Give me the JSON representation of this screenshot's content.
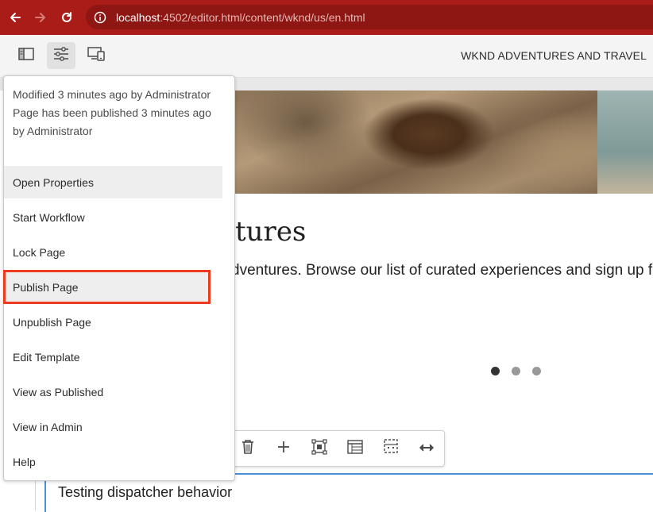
{
  "browser": {
    "url_host": "localhost",
    "url_rest": ":4502/editor.html/content/wknd/us/en.html",
    "icons": [
      "back-arrow-icon",
      "forward-arrow-icon",
      "reload-icon",
      "site-info-icon"
    ]
  },
  "toolbar": {
    "page_name": "WKND ADVENTURES AND TRAVEL",
    "buttons": [
      "side-panel-toggle",
      "page-information",
      "emulator"
    ]
  },
  "page": {
    "hero_title": "tures",
    "hero_text": "dventures. Browse our list of curated experiences and sign up fo",
    "carousel_dots": 3,
    "carousel_active_index": 0,
    "selected_component_text": "Testing dispatcher behavior"
  },
  "popover": {
    "info_line1": "Modified 3 minutes ago by Administrator",
    "info_line2": "Page has been published 3 minutes ago by Administrator",
    "items": [
      {
        "label": "Open Properties"
      },
      {
        "label": "Start Workflow"
      },
      {
        "label": "Lock Page"
      },
      {
        "label": "Publish Page"
      },
      {
        "label": "Unpublish Page"
      },
      {
        "label": "Edit Template"
      },
      {
        "label": "View as Published"
      },
      {
        "label": "View in Admin"
      },
      {
        "label": "Help"
      }
    ],
    "highlighted_item": "Publish Page"
  },
  "colors": {
    "browser_bar": "#a91c18",
    "highlight": "#ee3b1f",
    "selection_border": "#4a8fdc"
  }
}
